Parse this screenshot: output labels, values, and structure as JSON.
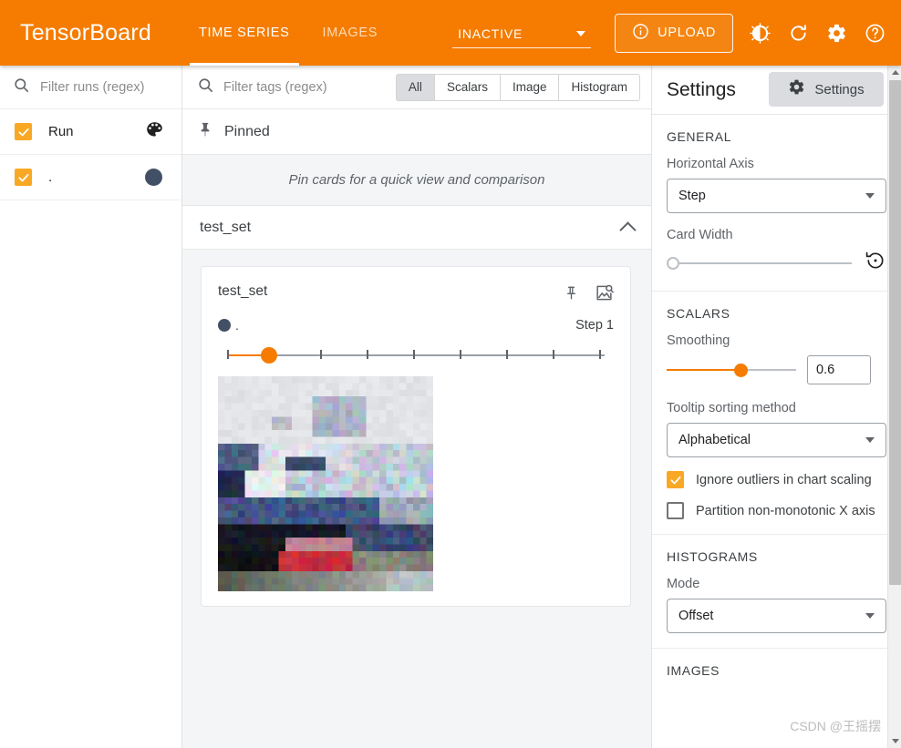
{
  "app": {
    "brand": "TensorBoard",
    "accent_color": "#f57c00",
    "run_dot_color": "#425066"
  },
  "topbar": {
    "tabs": [
      {
        "label": "TIME SERIES",
        "active": true
      },
      {
        "label": "IMAGES",
        "active": false
      }
    ],
    "run_selector": {
      "value": "INACTIVE",
      "icon": "chevron-down-icon"
    },
    "upload_label": "UPLOAD",
    "upload_icon": "info-circle-icon",
    "icons": [
      "brightness-icon",
      "refresh-icon",
      "gear-icon",
      "help-circle-icon"
    ]
  },
  "sidebar": {
    "filter": {
      "placeholder": "Filter runs (regex)",
      "value": "",
      "icon": "search-icon"
    },
    "header_row": {
      "label": "Run",
      "icon": "palette-icon",
      "checked": true
    },
    "runs": [
      {
        "label": ".",
        "checked": true,
        "color": "#425066"
      }
    ]
  },
  "main": {
    "tag_filter": {
      "placeholder": "Filter tags (regex)",
      "value": "",
      "icon": "search-icon"
    },
    "type_toggles": [
      {
        "label": "All",
        "selected": true
      },
      {
        "label": "Scalars",
        "selected": false
      },
      {
        "label": "Image",
        "selected": false
      },
      {
        "label": "Histogram",
        "selected": false
      }
    ],
    "settings_button": {
      "label": "Settings",
      "icon": "gear-icon"
    },
    "pinned": {
      "label": "Pinned",
      "icon": "pin-icon",
      "empty_message": "Pin cards for a quick view and comparison"
    },
    "group": {
      "name": "test_set",
      "expanded": true,
      "icon": "chevron-up-icon"
    },
    "card": {
      "title": "test_set",
      "pin_icon": "pin-icon",
      "fullscreen_icon": "image-search-icon",
      "run_name": ".",
      "run_color": "#425066",
      "step_label": "Step 1",
      "step_value": 1,
      "slider": {
        "value_percent": 11,
        "tick_count": 9
      },
      "image_alt": "ship"
    }
  },
  "settings": {
    "title": "Settings",
    "close_icon": "close-icon",
    "sections": [
      {
        "caption": "GENERAL",
        "horizontal_axis": {
          "label": "Horizontal Axis",
          "value": "Step"
        },
        "card_width": {
          "label": "Card Width",
          "value_percent": 0,
          "reset_icon": "restore-icon"
        }
      },
      {
        "caption": "SCALARS",
        "smoothing": {
          "label": "Smoothing",
          "value": "0.6",
          "value_percent": 58
        },
        "tooltip_sorting": {
          "label": "Tooltip sorting method",
          "value": "Alphabetical"
        },
        "checkboxes": [
          {
            "label": "Ignore outliers in chart scaling",
            "checked": true
          },
          {
            "label": "Partition non-monotonic X axis",
            "checked": false
          }
        ]
      },
      {
        "caption": "HISTOGRAMS",
        "mode": {
          "label": "Mode",
          "value": "Offset"
        }
      },
      {
        "caption": "IMAGES"
      }
    ]
  },
  "watermark": "CSDN @王摇摆"
}
